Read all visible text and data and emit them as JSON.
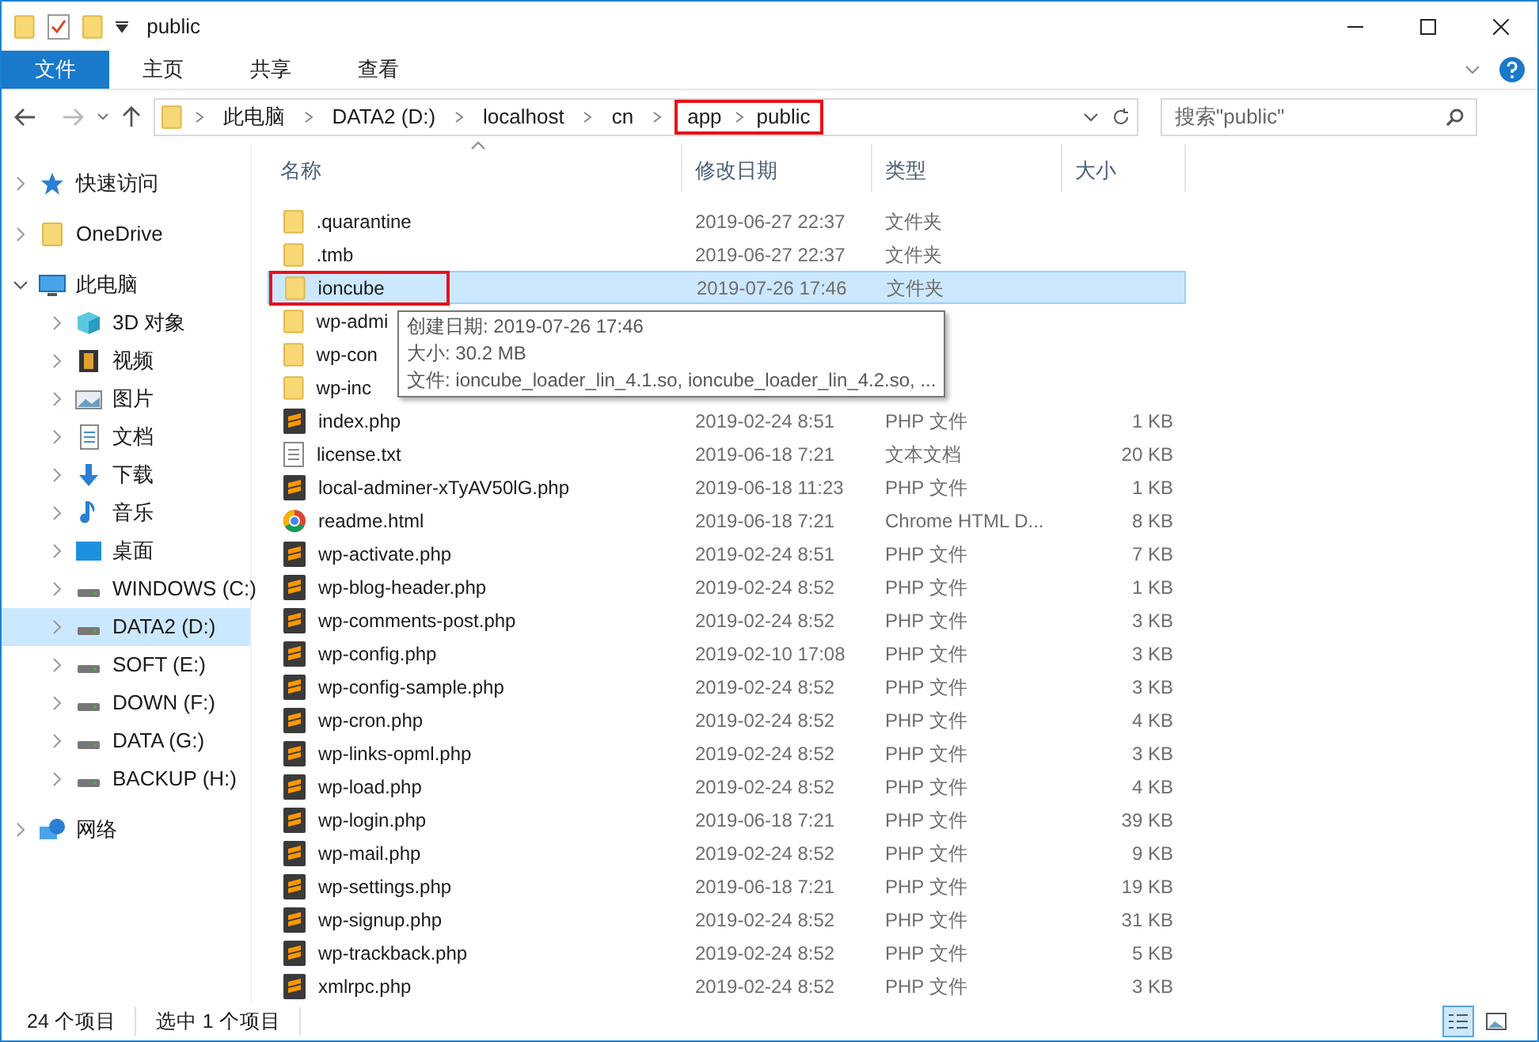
{
  "window": {
    "title": "public"
  },
  "ribbon_tabs": [
    {
      "label": "文件",
      "selected": true
    },
    {
      "label": "主页",
      "selected": false
    },
    {
      "label": "共享",
      "selected": false
    },
    {
      "label": "查看",
      "selected": false
    }
  ],
  "breadcrumb": [
    {
      "label": "此电脑",
      "highlighted": false
    },
    {
      "label": "DATA2 (D:)",
      "highlighted": false
    },
    {
      "label": "localhost",
      "highlighted": false
    },
    {
      "label": "cn",
      "highlighted": false
    },
    {
      "label": "app",
      "highlighted": true
    },
    {
      "label": "public",
      "highlighted": true
    }
  ],
  "search": {
    "placeholder": "搜索\"public\""
  },
  "sidebar": {
    "items": [
      {
        "label": "快速访问",
        "kind": "star",
        "expanded": false,
        "selected": false
      },
      {
        "label": "OneDrive",
        "kind": "folder",
        "expanded": false,
        "selected": false
      },
      {
        "label": "此电脑",
        "kind": "pc",
        "expanded": true,
        "selected": false,
        "children": [
          {
            "label": "3D 对象",
            "kind": "cube",
            "selected": false
          },
          {
            "label": "视频",
            "kind": "video",
            "selected": false
          },
          {
            "label": "图片",
            "kind": "picture",
            "selected": false
          },
          {
            "label": "文档",
            "kind": "doc",
            "selected": false
          },
          {
            "label": "下载",
            "kind": "download",
            "selected": false
          },
          {
            "label": "音乐",
            "kind": "music",
            "selected": false
          },
          {
            "label": "桌面",
            "kind": "desktop",
            "selected": false
          },
          {
            "label": "WINDOWS (C:)",
            "kind": "drive",
            "selected": false
          },
          {
            "label": "DATA2 (D:)",
            "kind": "drive",
            "selected": true
          },
          {
            "label": "SOFT (E:)",
            "kind": "drive",
            "selected": false
          },
          {
            "label": "DOWN (F:)",
            "kind": "drive",
            "selected": false
          },
          {
            "label": "DATA (G:)",
            "kind": "drive",
            "selected": false
          },
          {
            "label": "BACKUP (H:)",
            "kind": "drive",
            "selected": false
          }
        ]
      },
      {
        "label": "网络",
        "kind": "network",
        "expanded": false,
        "selected": false
      }
    ]
  },
  "table": {
    "columns": [
      "名称",
      "修改日期",
      "类型",
      "大小"
    ],
    "rows": [
      {
        "kind": "folder",
        "name": ".quarantine",
        "date": "2019-06-27 22:37",
        "type": "文件夹",
        "selected": false,
        "highlighted": false
      },
      {
        "kind": "folder",
        "name": ".tmb",
        "date": "2019-06-27 22:37",
        "type": "文件夹",
        "selected": false,
        "highlighted": false
      },
      {
        "kind": "folder",
        "name": "ioncube",
        "date": "2019-07-26 17:46",
        "type": "文件夹",
        "selected": true,
        "highlighted": true
      },
      {
        "kind": "folder",
        "name": "wp-admi",
        "selected": false,
        "highlighted": false
      },
      {
        "kind": "folder",
        "name": "wp-con",
        "selected": false,
        "highlighted": false
      },
      {
        "kind": "folder",
        "name": "wp-inc",
        "selected": false,
        "highlighted": false
      },
      {
        "kind": "php",
        "name": "index.php",
        "date": "2019-02-24 8:51",
        "type": "PHP 文件",
        "size": "1 KB",
        "selected": false,
        "highlighted": false
      },
      {
        "kind": "txt",
        "name": "license.txt",
        "date": "2019-06-18 7:21",
        "type": "文本文档",
        "size": "20 KB",
        "selected": false,
        "highlighted": false
      },
      {
        "kind": "php",
        "name": "local-adminer-xTyAV50lG.php",
        "date": "2019-06-18 11:23",
        "type": "PHP 文件",
        "size": "1 KB",
        "selected": false,
        "highlighted": false
      },
      {
        "kind": "html",
        "name": "readme.html",
        "date": "2019-06-18 7:21",
        "type": "Chrome HTML D...",
        "size": "8 KB",
        "selected": false,
        "highlighted": false
      },
      {
        "kind": "php",
        "name": "wp-activate.php",
        "date": "2019-02-24 8:51",
        "type": "PHP 文件",
        "size": "7 KB",
        "selected": false,
        "highlighted": false
      },
      {
        "kind": "php",
        "name": "wp-blog-header.php",
        "date": "2019-02-24 8:52",
        "type": "PHP 文件",
        "size": "1 KB",
        "selected": false,
        "highlighted": false
      },
      {
        "kind": "php",
        "name": "wp-comments-post.php",
        "date": "2019-02-24 8:52",
        "type": "PHP 文件",
        "size": "3 KB",
        "selected": false,
        "highlighted": false
      },
      {
        "kind": "php",
        "name": "wp-config.php",
        "date": "2019-02-10 17:08",
        "type": "PHP 文件",
        "size": "3 KB",
        "selected": false,
        "highlighted": false
      },
      {
        "kind": "php",
        "name": "wp-config-sample.php",
        "date": "2019-02-24 8:52",
        "type": "PHP 文件",
        "size": "3 KB",
        "selected": false,
        "highlighted": false
      },
      {
        "kind": "php",
        "name": "wp-cron.php",
        "date": "2019-02-24 8:52",
        "type": "PHP 文件",
        "size": "4 KB",
        "selected": false,
        "highlighted": false
      },
      {
        "kind": "php",
        "name": "wp-links-opml.php",
        "date": "2019-02-24 8:52",
        "type": "PHP 文件",
        "size": "3 KB",
        "selected": false,
        "highlighted": false
      },
      {
        "kind": "php",
        "name": "wp-load.php",
        "date": "2019-02-24 8:52",
        "type": "PHP 文件",
        "size": "4 KB",
        "selected": false,
        "highlighted": false
      },
      {
        "kind": "php",
        "name": "wp-login.php",
        "date": "2019-06-18 7:21",
        "type": "PHP 文件",
        "size": "39 KB",
        "selected": false,
        "highlighted": false
      },
      {
        "kind": "php",
        "name": "wp-mail.php",
        "date": "2019-02-24 8:52",
        "type": "PHP 文件",
        "size": "9 KB",
        "selected": false,
        "highlighted": false
      },
      {
        "kind": "php",
        "name": "wp-settings.php",
        "date": "2019-06-18 7:21",
        "type": "PHP 文件",
        "size": "19 KB",
        "selected": false,
        "highlighted": false
      },
      {
        "kind": "php",
        "name": "wp-signup.php",
        "date": "2019-02-24 8:52",
        "type": "PHP 文件",
        "size": "31 KB",
        "selected": false,
        "highlighted": false
      },
      {
        "kind": "php",
        "name": "wp-trackback.php",
        "date": "2019-02-24 8:52",
        "type": "PHP 文件",
        "size": "5 KB",
        "selected": false,
        "highlighted": false
      },
      {
        "kind": "php",
        "name": "xmlrpc.php",
        "date": "2019-02-24 8:52",
        "type": "PHP 文件",
        "size": "3 KB",
        "selected": false,
        "highlighted": false
      }
    ]
  },
  "tooltip": {
    "lines": [
      "创建日期: 2019-07-26 17:46",
      "大小: 30.2 MB",
      "文件: ioncube_loader_lin_4.1.so, ioncube_loader_lin_4.2.so, ..."
    ]
  },
  "status_bar": {
    "item_count": "24 个项目",
    "selection": "选中 1 个项目"
  }
}
